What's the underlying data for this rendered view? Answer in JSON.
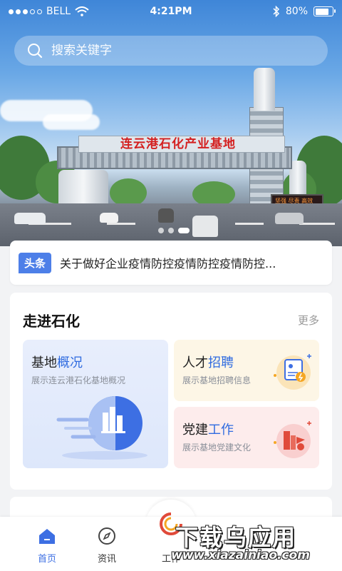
{
  "status_bar": {
    "carrier": "BELL",
    "time": "4:21PM",
    "battery": "80%"
  },
  "search": {
    "placeholder": "搜索关键字"
  },
  "banner": {
    "gate_text": "连云港石化产业基地",
    "led_text": "坚强 尽责 高效 创新",
    "slide_count": 3,
    "active_slide": 3
  },
  "headline": {
    "badge": "头条",
    "text": "关于做好企业疫情防控疫情防控疫情防控..."
  },
  "section": {
    "title": "走进石化",
    "more": "更多",
    "cards": [
      {
        "title_a": "基地",
        "title_b": "概况",
        "subtitle": "展示连云港石化基地概况"
      },
      {
        "title_a": "人才",
        "title_b": "招聘",
        "subtitle": "展示基地招聘信息"
      },
      {
        "title_a": "党建",
        "title_b": "工作",
        "subtitle": "展示基地党建文化"
      }
    ]
  },
  "tabs": [
    {
      "label": "首页",
      "active": true,
      "icon": "home-icon"
    },
    {
      "label": "资讯",
      "active": false,
      "icon": "compass-icon"
    },
    {
      "label": "工作",
      "active": false,
      "icon": "logo-icon"
    }
  ],
  "watermark": {
    "main": "下载乌应用",
    "url": "www.xiazainiao.com"
  },
  "colors": {
    "accent": "#3d6fe3",
    "badge": "#4d7fe8",
    "party_red": "#e04a3a"
  }
}
